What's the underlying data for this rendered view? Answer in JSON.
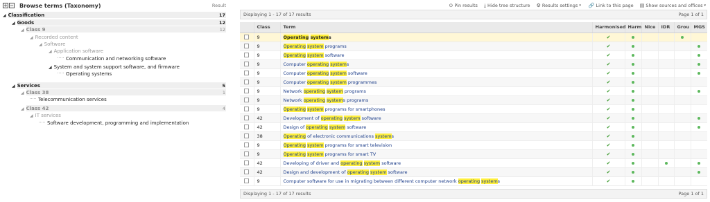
{
  "left": {
    "title": "Browse terms (Taxonomy)",
    "result_label": "Result",
    "expand_icon": "plus",
    "collapse_icon": "minus"
  },
  "tree": [
    {
      "label": "Classification",
      "count": "17",
      "level": 0
    },
    {
      "label": "Goods",
      "count": "12",
      "level": 1
    },
    {
      "label": "Class 9",
      "count": "12",
      "level": 2
    },
    {
      "label": "Recorded content",
      "count": "",
      "level": 3
    },
    {
      "label": "Software",
      "count": "",
      "level": 4
    },
    {
      "label": "Application software",
      "count": "",
      "level": 5
    },
    {
      "label": "Communication and networking software",
      "count": "",
      "level": 6
    },
    {
      "label": "System and system support software, and firmware",
      "count": "",
      "level": 5
    },
    {
      "label": "Operating systems",
      "count": "",
      "level": 6
    },
    {
      "label": "Services",
      "count": "5",
      "level": 1
    },
    {
      "label": "Class 38",
      "count": "1",
      "level": 2
    },
    {
      "label": "Telecommunication services",
      "count": "",
      "level": 3
    },
    {
      "label": "Class 42",
      "count": "4",
      "level": 2
    },
    {
      "label": "IT services",
      "count": "",
      "level": 3
    },
    {
      "label": "Software development, programming and implementation",
      "count": "",
      "level": 4
    }
  ],
  "toolbar": {
    "pin": "Pin results",
    "hide_tree": "Hide tree structure",
    "settings": "Results settings",
    "link": "Link to this page",
    "show_sources": "Show sources and offices"
  },
  "display_top": "Displaying 1 - 17 of 17 results",
  "display_bottom": "Displaying 1 - 17 of 17 results",
  "page_info": "Page 1 of 1",
  "columns": [
    "",
    "Class",
    "Term",
    "Harmonised",
    "Harm",
    "Nice",
    "IDR",
    "Grou",
    "MGS"
  ],
  "rows": [
    {
      "cls": "9",
      "term": [
        [
          "Operating",
          true
        ],
        [
          " ",
          false
        ],
        [
          "system",
          true
        ],
        [
          "s",
          false
        ]
      ],
      "harmonised": true,
      "harm": true,
      "nice": false,
      "idr": false,
      "grou": true,
      "mgs": false
    },
    {
      "cls": "9",
      "term": [
        [
          "Operating",
          true
        ],
        [
          " ",
          false
        ],
        [
          "system",
          true
        ],
        [
          " programs",
          false
        ]
      ],
      "harmonised": true,
      "harm": true,
      "nice": false,
      "idr": false,
      "grou": false,
      "mgs": true
    },
    {
      "cls": "9",
      "term": [
        [
          "Operating",
          true
        ],
        [
          " ",
          false
        ],
        [
          "system",
          true
        ],
        [
          " software",
          false
        ]
      ],
      "harmonised": true,
      "harm": true,
      "nice": false,
      "idr": false,
      "grou": false,
      "mgs": true
    },
    {
      "cls": "9",
      "term": [
        [
          "Computer ",
          false
        ],
        [
          "operating",
          true
        ],
        [
          " ",
          false
        ],
        [
          "system",
          true
        ],
        [
          "s",
          false
        ]
      ],
      "harmonised": true,
      "harm": true,
      "nice": false,
      "idr": false,
      "grou": false,
      "mgs": true
    },
    {
      "cls": "9",
      "term": [
        [
          "Computer ",
          false
        ],
        [
          "operating",
          true
        ],
        [
          " ",
          false
        ],
        [
          "system",
          true
        ],
        [
          " software",
          false
        ]
      ],
      "harmonised": true,
      "harm": true,
      "nice": false,
      "idr": false,
      "grou": false,
      "mgs": true
    },
    {
      "cls": "9",
      "term": [
        [
          "Computer ",
          false
        ],
        [
          "operating",
          true
        ],
        [
          " ",
          false
        ],
        [
          "system",
          true
        ],
        [
          " programmes",
          false
        ]
      ],
      "harmonised": true,
      "harm": true,
      "nice": false,
      "idr": false,
      "grou": false,
      "mgs": false
    },
    {
      "cls": "9",
      "term": [
        [
          "Network ",
          false
        ],
        [
          "operating",
          true
        ],
        [
          " ",
          false
        ],
        [
          "system",
          true
        ],
        [
          " programs",
          false
        ]
      ],
      "harmonised": true,
      "harm": true,
      "nice": false,
      "idr": false,
      "grou": false,
      "mgs": true
    },
    {
      "cls": "9",
      "term": [
        [
          "Network ",
          false
        ],
        [
          "operating",
          true
        ],
        [
          " ",
          false
        ],
        [
          "system",
          true
        ],
        [
          "s programs",
          false
        ]
      ],
      "harmonised": true,
      "harm": true,
      "nice": false,
      "idr": false,
      "grou": false,
      "mgs": false
    },
    {
      "cls": "9",
      "term": [
        [
          "Operating",
          true
        ],
        [
          " ",
          false
        ],
        [
          "system",
          true
        ],
        [
          " programs for smartphones",
          false
        ]
      ],
      "harmonised": true,
      "harm": true,
      "nice": false,
      "idr": false,
      "grou": false,
      "mgs": false
    },
    {
      "cls": "42",
      "term": [
        [
          "Development of ",
          false
        ],
        [
          "operating",
          true
        ],
        [
          " ",
          false
        ],
        [
          "system",
          true
        ],
        [
          " software",
          false
        ]
      ],
      "harmonised": true,
      "harm": true,
      "nice": false,
      "idr": false,
      "grou": false,
      "mgs": true
    },
    {
      "cls": "42",
      "term": [
        [
          "Design of ",
          false
        ],
        [
          "operating",
          true
        ],
        [
          " ",
          false
        ],
        [
          "system",
          true
        ],
        [
          " software",
          false
        ]
      ],
      "harmonised": true,
      "harm": true,
      "nice": false,
      "idr": false,
      "grou": false,
      "mgs": true
    },
    {
      "cls": "38",
      "term": [
        [
          "Operating",
          true
        ],
        [
          " of electronic communications ",
          false
        ],
        [
          "system",
          true
        ],
        [
          "s",
          false
        ]
      ],
      "harmonised": true,
      "harm": true,
      "nice": false,
      "idr": false,
      "grou": false,
      "mgs": false
    },
    {
      "cls": "9",
      "term": [
        [
          "Operating",
          true
        ],
        [
          " ",
          false
        ],
        [
          "system",
          true
        ],
        [
          " programs for smart television",
          false
        ]
      ],
      "harmonised": true,
      "harm": true,
      "nice": false,
      "idr": false,
      "grou": false,
      "mgs": false
    },
    {
      "cls": "9",
      "term": [
        [
          "Operating",
          true
        ],
        [
          " ",
          false
        ],
        [
          "system",
          true
        ],
        [
          " programs for smart TV",
          false
        ]
      ],
      "harmonised": true,
      "harm": true,
      "nice": false,
      "idr": false,
      "grou": false,
      "mgs": false
    },
    {
      "cls": "42",
      "term": [
        [
          "Developing of driver and ",
          false
        ],
        [
          "operating",
          true
        ],
        [
          " ",
          false
        ],
        [
          "system",
          true
        ],
        [
          " software",
          false
        ]
      ],
      "harmonised": true,
      "harm": true,
      "nice": false,
      "idr": true,
      "grou": false,
      "mgs": true
    },
    {
      "cls": "42",
      "term": [
        [
          "Design and development of ",
          false
        ],
        [
          "operating",
          true
        ],
        [
          " ",
          false
        ],
        [
          "system",
          true
        ],
        [
          " software",
          false
        ]
      ],
      "harmonised": true,
      "harm": true,
      "nice": false,
      "idr": false,
      "grou": false,
      "mgs": true
    },
    {
      "cls": "9",
      "term": [
        [
          "Computer software for use in migrating between different computer network ",
          false
        ],
        [
          "operating",
          true
        ],
        [
          " ",
          false
        ],
        [
          "system",
          true
        ],
        [
          "s",
          false
        ]
      ],
      "harmonised": true,
      "harm": true,
      "nice": false,
      "idr": false,
      "grou": false,
      "mgs": false
    }
  ],
  "colors": {
    "highlight": "#ffef3a",
    "tick": "#3c9a2e",
    "dot": "#5cb85c",
    "link": "#1d3e8a"
  }
}
